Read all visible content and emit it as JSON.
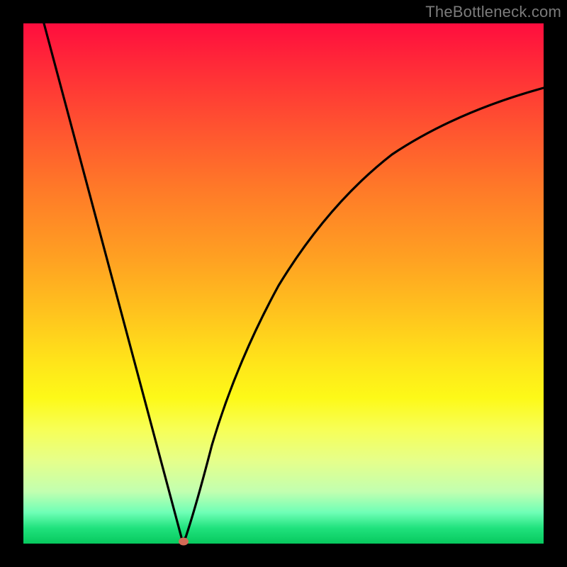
{
  "watermark": "TheBottleneck.com",
  "chart_data": {
    "type": "line",
    "title": "",
    "xlabel": "",
    "ylabel": "",
    "xlim": [
      0,
      1
    ],
    "ylim": [
      0,
      1
    ],
    "min_marker": {
      "x": 0.305,
      "y": 0.003,
      "color": "#d36a56"
    },
    "series": [
      {
        "name": "curve",
        "x": [
          0.04,
          0.08,
          0.12,
          0.16,
          0.2,
          0.24,
          0.28,
          0.3,
          0.305,
          0.315,
          0.33,
          0.36,
          0.4,
          0.45,
          0.5,
          0.56,
          0.62,
          0.7,
          0.78,
          0.86,
          0.94,
          1.0
        ],
        "y": [
          1.0,
          0.853,
          0.706,
          0.559,
          0.412,
          0.265,
          0.118,
          0.044,
          0.006,
          0.01,
          0.06,
          0.19,
          0.34,
          0.47,
          0.565,
          0.65,
          0.71,
          0.77,
          0.81,
          0.84,
          0.862,
          0.876
        ]
      }
    ],
    "notes": "Axes are unlabeled; values are normalized 0–1 estimates read from pixel positions."
  }
}
